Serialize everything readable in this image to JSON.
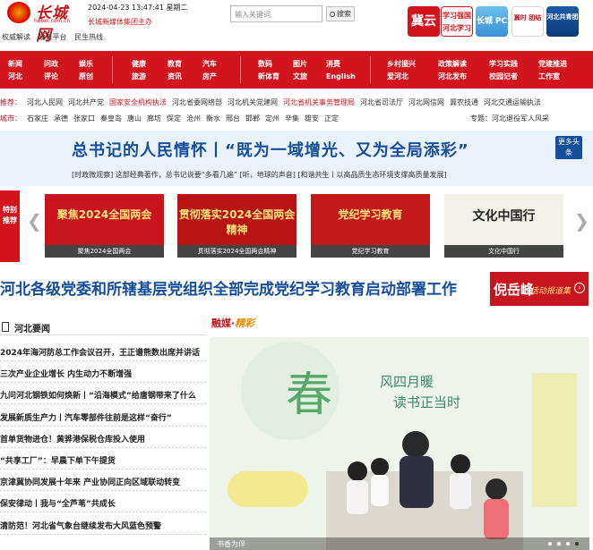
{
  "header": {
    "logo_text": "长城网",
    "logo_sub": "hebei.com.cn",
    "links": [
      "权威解读",
      "政务平台",
      "民生热线"
    ],
    "datetime": "2024-04-23 13:47:41 星期二",
    "slogan": "长城新媒体集团主办",
    "search_placeholder": "输入关键词",
    "search_button": "搜索",
    "apps": [
      "冀云",
      "学习强国 河北学习平台",
      "长城 PC",
      "冀时 团结",
      "河北共青团"
    ]
  },
  "nav": {
    "cols": [
      [
        "新闻",
        "河北"
      ],
      [
        "问政",
        "评论"
      ],
      [
        "娱乐",
        "原创"
      ],
      [
        "健康",
        "旅游"
      ],
      [
        "教育",
        "资讯"
      ],
      [
        "汽车",
        "房产"
      ],
      [
        "数码",
        "新体育"
      ],
      [
        "图片",
        "文旅"
      ],
      [
        "消费",
        "English"
      ],
      [
        "乡村振兴",
        "爱河北"
      ],
      [
        "政策解读",
        "河北发布"
      ],
      [
        "学习实践",
        "校园记者"
      ],
      [
        "党建推进",
        "工作室"
      ]
    ]
  },
  "quicklinks": {
    "row1": [
      "推荐：",
      "河北人民网",
      "河北共产党",
      "国家安全机构执法",
      "河北省委网络部",
      "河北机关党建网",
      "河北省机关事务管理局",
      "河北省司法厅",
      "河北网信网",
      "冀农技通",
      "河北交通运输执法"
    ],
    "row2": [
      "城市：",
      "石家庄",
      "承德",
      "张家口",
      "秦皇岛",
      "唐山",
      "廊坊",
      "保定",
      "沧州",
      "衡水",
      "邢台",
      "邯郸",
      "定州",
      "辛集",
      "雄安",
      "正定"
    ],
    "row2_right": "专题：河北退役军人风采"
  },
  "banner": {
    "title": "总书记的人民情怀丨“既为一域增光、又为全局添彩”",
    "sub": "[时政微观察] 这部经典著作，总书记说要“多看几遍”   [听，地球的声音]   [和谐共生丨以高品质生态环境支撑高质量发展]",
    "more": "更多头条"
  },
  "slider": {
    "tag": "特别推荐",
    "cards": [
      {
        "title": "聚焦2024全国两会",
        "caption": "聚焦2024全国两会",
        "color": "#c8141c"
      },
      {
        "title": "贯彻落实2024全国两会精神",
        "caption": "贯彻落实2024全国两会精神",
        "color": "#b81414"
      },
      {
        "title": "党纪学习教育",
        "caption": "党纪学习教育",
        "color": "#c21a1a"
      },
      {
        "title": "文化中国行",
        "caption": "文化中国行",
        "color": "#f3f0e8"
      }
    ]
  },
  "headline": "河北各级党委和所辖基层党组织全部完成党纪学习教育启动部署工作",
  "live_badge": {
    "name": "倪岳峰",
    "text": "活动报道集"
  },
  "news": {
    "title": "河北要闻",
    "items": [
      "2024年海河防总工作会议召开，王正谱熊数出席并讲话",
      "三次产业企业增长 内生动力不断增强",
      "九问河北钢铁如何焕新丨“沿海模式”给唐钢带来了什么",
      "发展新质生产力丨汽车零部件往前是这样“奋行”",
      "首单货物进仓！黄骅港保税仓库投入使用",
      "“共享工厂”：早晨下单下午提货",
      "京津冀协同发展十年来 产业协同正向区域联动转变",
      "保安律动丨我与“全芦苇”共成长",
      "清防范！河北省气象台继续发布大风蓝色预警"
    ]
  },
  "media": {
    "label_a": "融媒·",
    "label_b": "精彩",
    "photo_chars": [
      "春",
      "风四月暖",
      "读书正当时"
    ],
    "caption": "书香为伴"
  }
}
